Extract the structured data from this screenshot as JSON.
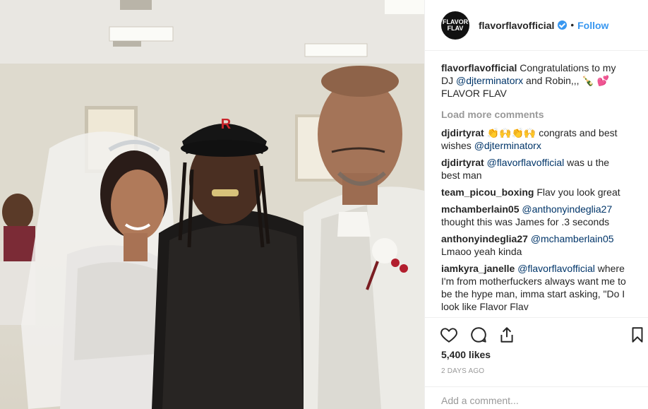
{
  "post": {
    "username": "flavorflavofficial",
    "avatar_text": "FLAVOR FLAV",
    "follow_label": "Follow",
    "separator": "•",
    "caption_user": "flavorflavofficial",
    "caption_text": "Congratulations to my DJ",
    "caption_mention": "@djterminatorx",
    "caption_rest": "and Robin,,, 🍾 💕FLAVOR FLAV",
    "load_more": "Load more comments",
    "likes": "5,400 likes",
    "time_ago": "2 DAYS AGO",
    "add_comment_placeholder": "Add a comment..."
  },
  "comments": [
    {
      "user": "djdirtyrat",
      "pre": "👏🙌👏🙌 congrats and best wishes",
      "mention": "@djterminatorx",
      "post": ""
    },
    {
      "user": "djdirtyrat",
      "pre": "",
      "mention": "@flavorflavofficial",
      "post": "was u the best man"
    },
    {
      "user": "team_picou_boxing",
      "pre": "Flav you look great",
      "mention": "",
      "post": ""
    },
    {
      "user": "mchamberlain05",
      "pre": "",
      "mention": "@anthonyindeglia27",
      "post": "thought this was James for .3 seconds"
    },
    {
      "user": "anthonyindeglia27",
      "pre": "",
      "mention": "@mchamberlain05",
      "post": "Lmaoo yeah kinda"
    },
    {
      "user": "iamkyra_janelle",
      "pre": "",
      "mention": "@flavorflavofficial",
      "post": "where I'm from motherfuckers always want me to be the hype man, imma start asking, \"Do I look like Flavor Flav"
    }
  ],
  "icons": {
    "like": "heart-icon",
    "comment": "comment-icon",
    "share": "share-icon",
    "save": "bookmark-icon",
    "verified": "verified-badge-icon"
  },
  "colors": {
    "accent": "#3897f0",
    "mention": "#003569",
    "muted": "#999999",
    "text": "#262626"
  }
}
